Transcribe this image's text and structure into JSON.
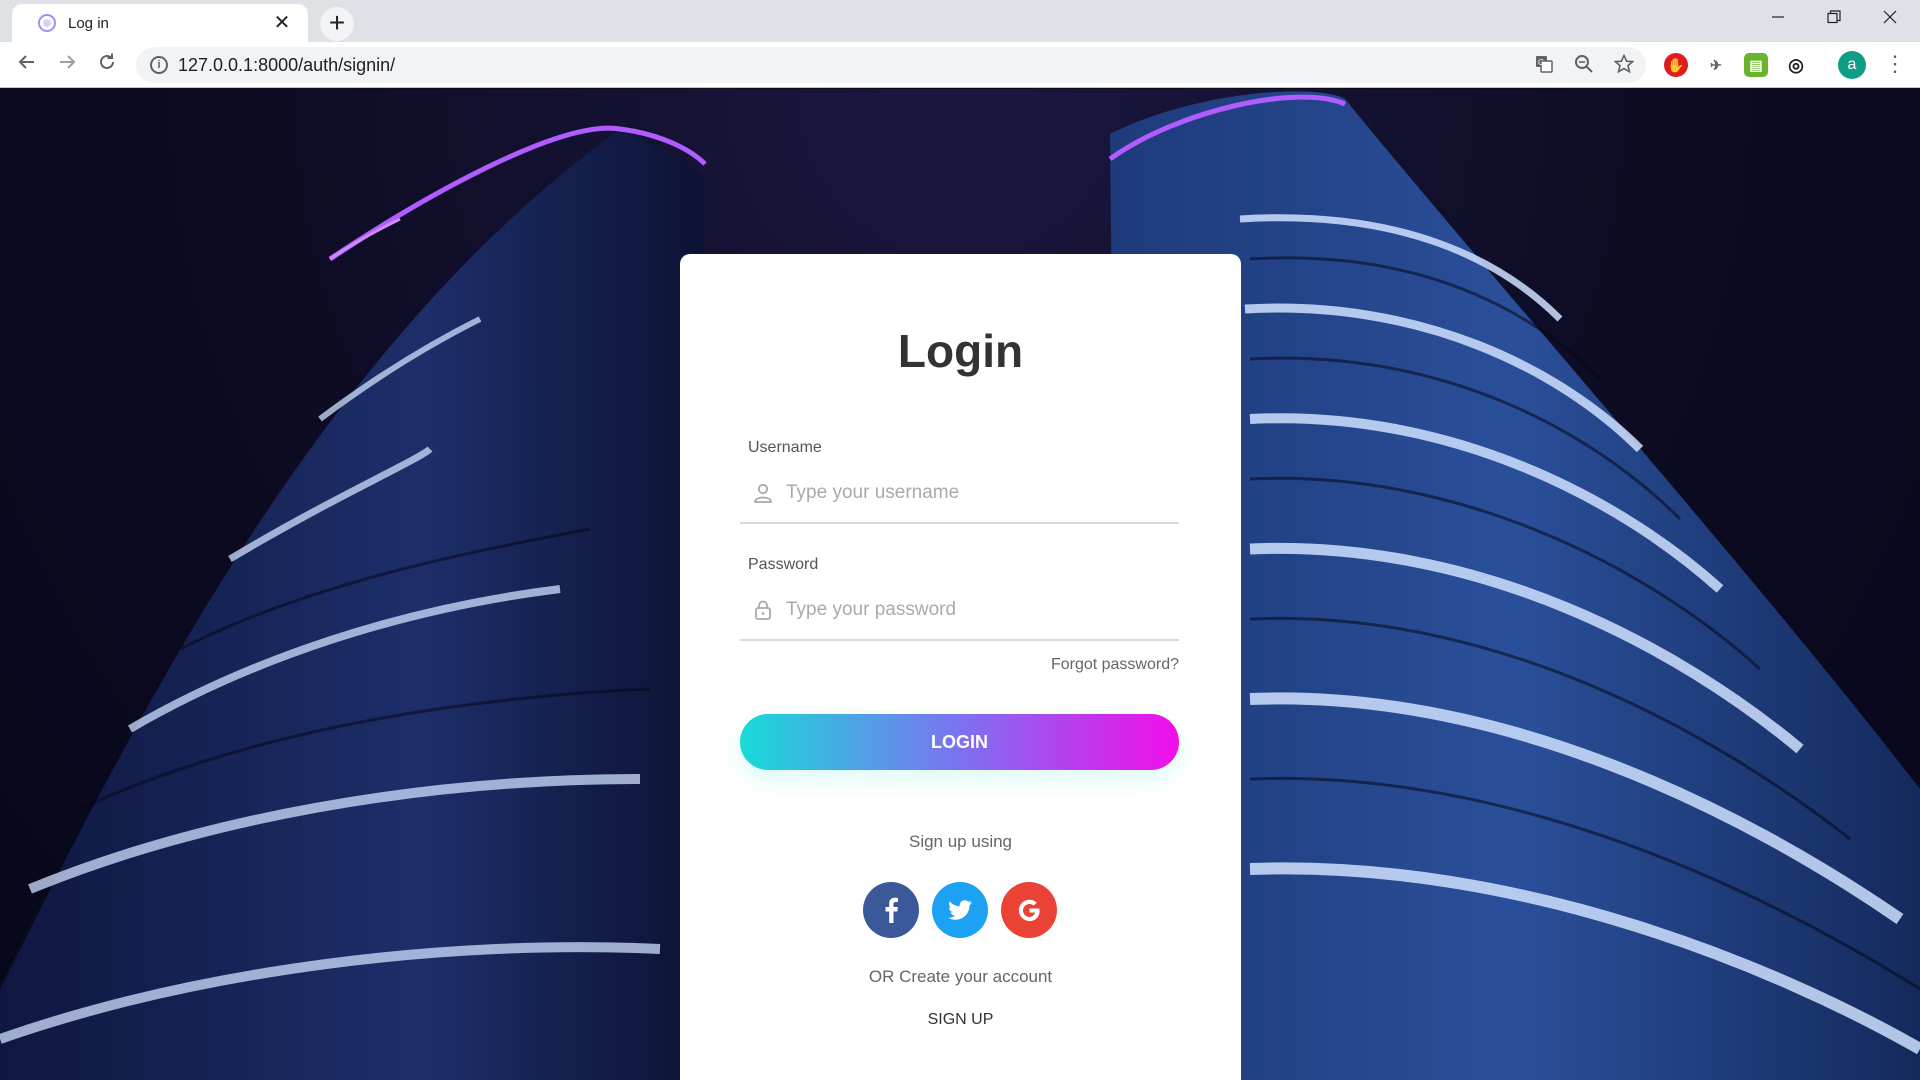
{
  "browser": {
    "tab_title": "Log in",
    "tab_close": "✕",
    "new_tab": "+",
    "url": "127.0.0.1:8000/auth/signin/",
    "profile_initial": "a"
  },
  "login": {
    "title": "Login",
    "username_label": "Username",
    "username_placeholder": "Type your username",
    "password_label": "Password",
    "password_placeholder": "Type your password",
    "forgot_password": "Forgot password?",
    "login_button": "LOGIN",
    "signup_using": "Sign up using",
    "or_create": "OR Create your account",
    "signup_link": "SIGN UP"
  },
  "colors": {
    "gradient_start": "#18dbd8",
    "gradient_end": "#f20de9",
    "facebook": "#3b5998",
    "twitter": "#1da1f2",
    "google": "#ea4335"
  },
  "icons": {
    "username": "user-icon",
    "password": "lock-icon",
    "socials": [
      "facebook-icon",
      "twitter-icon",
      "google-icon"
    ]
  }
}
